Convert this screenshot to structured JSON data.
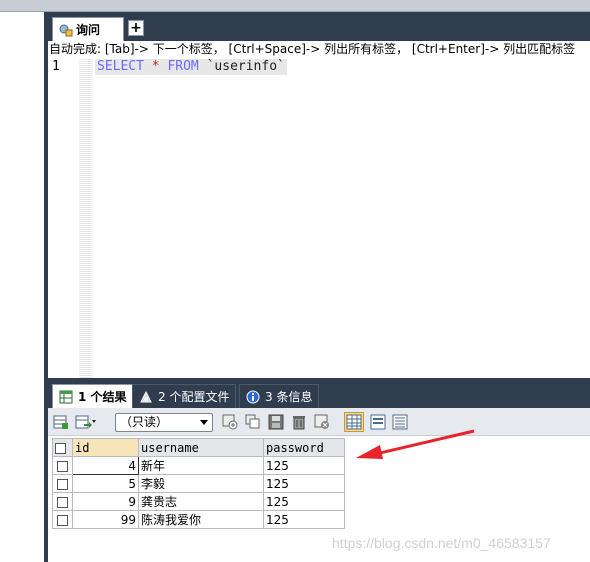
{
  "editor": {
    "query_tab_label": "询问",
    "add_tab_label": "+",
    "autocomplete_hint": "自动完成: [Tab]-> 下一个标签， [Ctrl+Space]-> 列出所有标签， [Ctrl+Enter]-> 列出匹配标签",
    "line_number": "1",
    "sql": {
      "select": "SELECT",
      "star": "*",
      "from": "FROM",
      "table": "`userinfo`"
    }
  },
  "result_tabs": [
    {
      "label": "1 个结果",
      "icon": "grid-results-icon",
      "active": true
    },
    {
      "label": "2 个配置文件",
      "icon": "profile-icon",
      "active": false
    },
    {
      "label": "3 条信息",
      "icon": "info-icon",
      "active": false
    }
  ],
  "toolbar": {
    "mode_select_value": "（只读）"
  },
  "grid": {
    "columns": [
      "id",
      "username",
      "password"
    ],
    "rows": [
      {
        "id": "4",
        "username": "新年",
        "password": "125"
      },
      {
        "id": "5",
        "username": "李毅",
        "password": "125"
      },
      {
        "id": "9",
        "username": "龚贵志",
        "password": "125"
      },
      {
        "id": "99",
        "username": "陈涛我爱你",
        "password": "125"
      }
    ]
  },
  "watermark": "https://blog.csdn.net/m0_46583157",
  "colors": {
    "dark_panel": "#2f3d4f",
    "keyword": "#6a6aff",
    "star": "#d3222a",
    "arrow": "#e8232b"
  }
}
